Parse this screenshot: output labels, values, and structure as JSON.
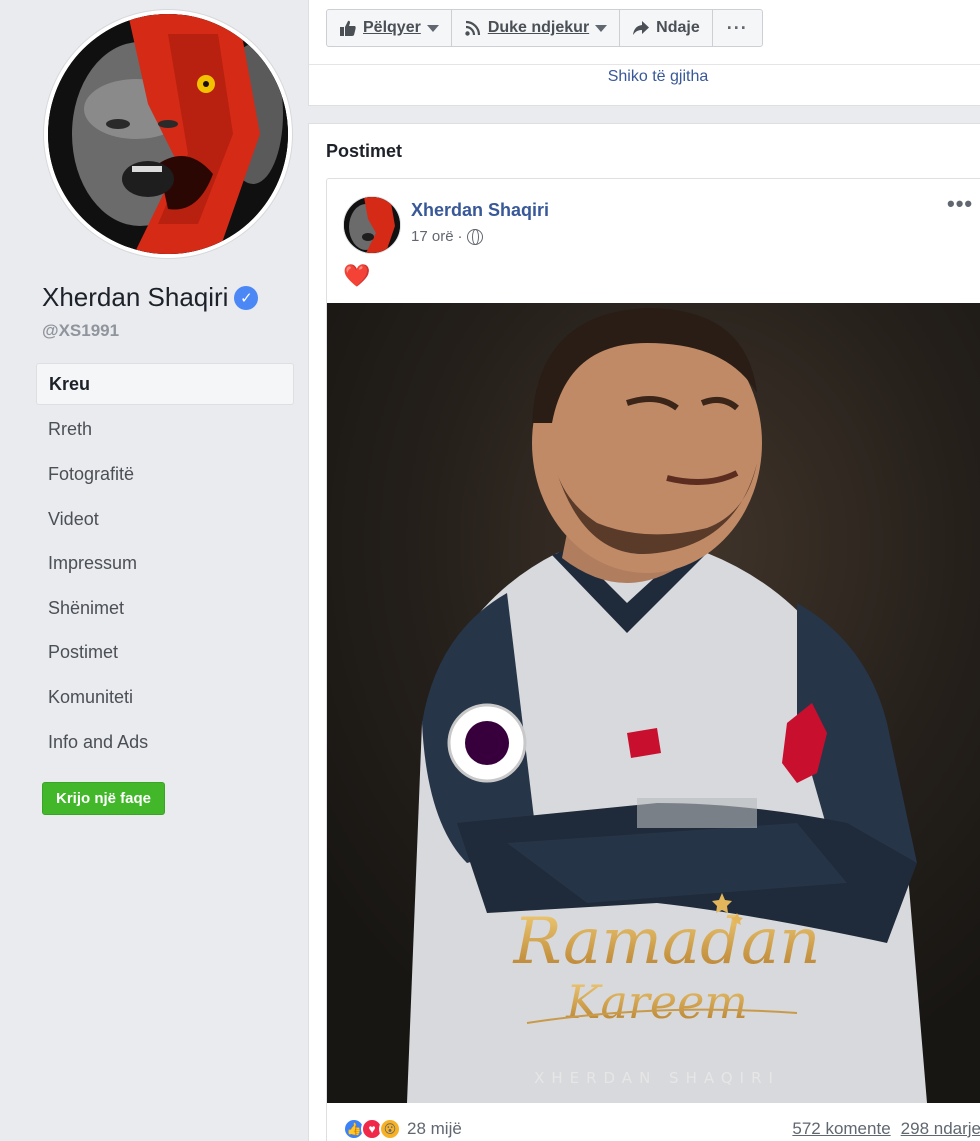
{
  "page": {
    "name": "Xherdan Shaqiri",
    "handle": "@XS1991",
    "verified": true
  },
  "sidebar": {
    "items": [
      {
        "label": "Kreu",
        "active": true
      },
      {
        "label": "Rreth"
      },
      {
        "label": "Fotografitë"
      },
      {
        "label": "Videot"
      },
      {
        "label": "Impressum"
      },
      {
        "label": "Shënimet"
      },
      {
        "label": "Postimet"
      },
      {
        "label": "Komuniteti"
      },
      {
        "label": "Info and Ads"
      }
    ],
    "create_page_label": "Krijo një faqe"
  },
  "actions": {
    "like_label": "Pëlqyer",
    "follow_label": "Duke ndjekur",
    "share_label": "Ndaje",
    "more_label": "···",
    "see_all": "Shiko të gjitha"
  },
  "posts": {
    "title": "Postimet",
    "post": {
      "author": "Xherdan Shaqiri",
      "time": "17 orë",
      "separator": "·",
      "text": "❤️",
      "more": "•••",
      "image": {
        "title_line1": "Ramadan",
        "title_line2": "Kareem",
        "caption": "XHERDAN SHAQIRI"
      },
      "reactions_count": "28 mijë",
      "comments": "572 komente",
      "shares": "298 ndarje"
    }
  },
  "colors": {
    "accent": "#385898",
    "green": "#42b72a",
    "background": "#e9ebee"
  }
}
